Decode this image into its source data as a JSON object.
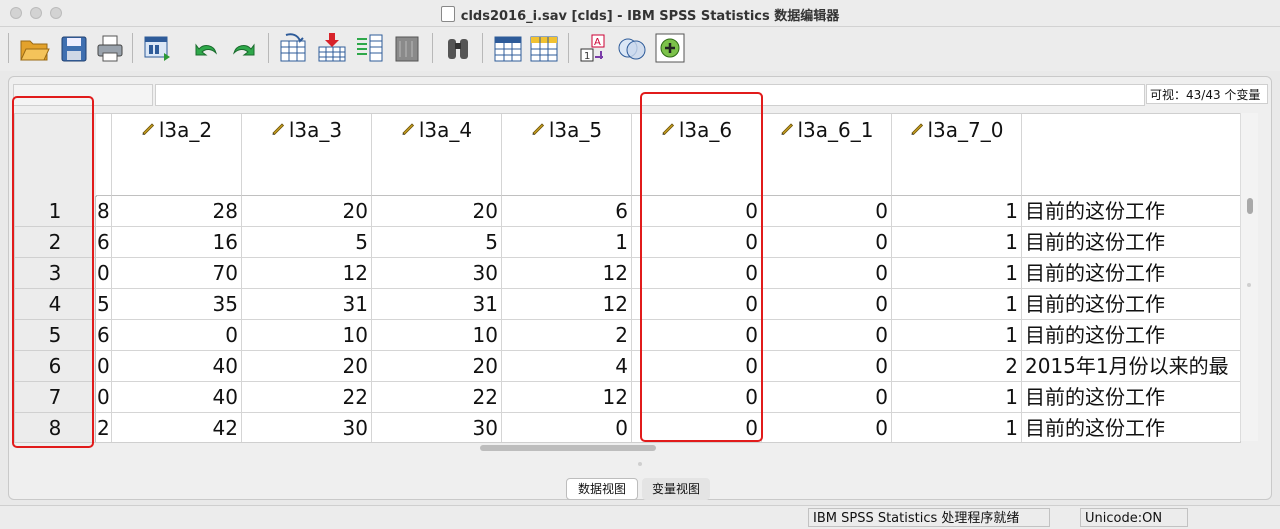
{
  "window": {
    "title": "clds2016_i.sav [clds] - IBM SPSS Statistics 数据编辑器"
  },
  "toolbar": {
    "buttons": [
      "open-icon",
      "save-icon",
      "print-icon",
      "dialog-recall-icon",
      "undo-icon",
      "redo-icon",
      "goto-case-icon",
      "goto-variable-icon",
      "variables-icon",
      "run-descriptives-icon",
      "find-icon",
      "insert-cases-icon",
      "insert-variable-icon",
      "split-file-icon",
      "weight-cases-icon",
      "select-cases-icon",
      "value-labels-icon",
      "use-variable-sets-icon"
    ]
  },
  "status_top": {
    "visible_label": "可视：43/43 个变量"
  },
  "grid": {
    "columns": [
      {
        "name": "",
        "partial": true
      },
      {
        "name": "l3a_2"
      },
      {
        "name": "l3a_3"
      },
      {
        "name": "l3a_4"
      },
      {
        "name": "l3a_5"
      },
      {
        "name": "l3a_6"
      },
      {
        "name": "l3a_6_1"
      },
      {
        "name": "l3a_7_0"
      },
      {
        "name": ""
      }
    ],
    "rows": [
      {
        "n": "1",
        "cells": [
          "8",
          "28",
          "20",
          "20",
          "6",
          "0",
          "0",
          "1",
          "目前的这份工作"
        ]
      },
      {
        "n": "2",
        "cells": [
          "6",
          "16",
          "5",
          "5",
          "1",
          "0",
          "0",
          "1",
          "目前的这份工作"
        ]
      },
      {
        "n": "3",
        "cells": [
          "0",
          "70",
          "12",
          "30",
          "12",
          "0",
          "0",
          "1",
          "目前的这份工作"
        ]
      },
      {
        "n": "4",
        "cells": [
          "5",
          "35",
          "31",
          "31",
          "12",
          "0",
          "0",
          "1",
          "目前的这份工作"
        ]
      },
      {
        "n": "5",
        "cells": [
          "6",
          "0",
          "10",
          "10",
          "2",
          "0",
          "0",
          "1",
          "目前的这份工作"
        ]
      },
      {
        "n": "6",
        "cells": [
          "0",
          "40",
          "20",
          "20",
          "4",
          "0",
          "0",
          "2",
          "2015年1月份以来的最"
        ]
      },
      {
        "n": "7",
        "cells": [
          "0",
          "40",
          "22",
          "22",
          "12",
          "0",
          "0",
          "1",
          "目前的这份工作"
        ]
      },
      {
        "n": "8",
        "cells": [
          "2",
          "42",
          "30",
          "30",
          "0",
          "0",
          "0",
          "1",
          "目前的这份工作"
        ]
      }
    ]
  },
  "tabs": {
    "data_view": "数据视图",
    "variable_view": "变量视图"
  },
  "statusbar": {
    "processor": "IBM SPSS Statistics 处理程序就绪",
    "unicode": "Unicode:ON"
  },
  "colors": {
    "highlight": "#e11b1b",
    "pencil": "#c8a020"
  }
}
